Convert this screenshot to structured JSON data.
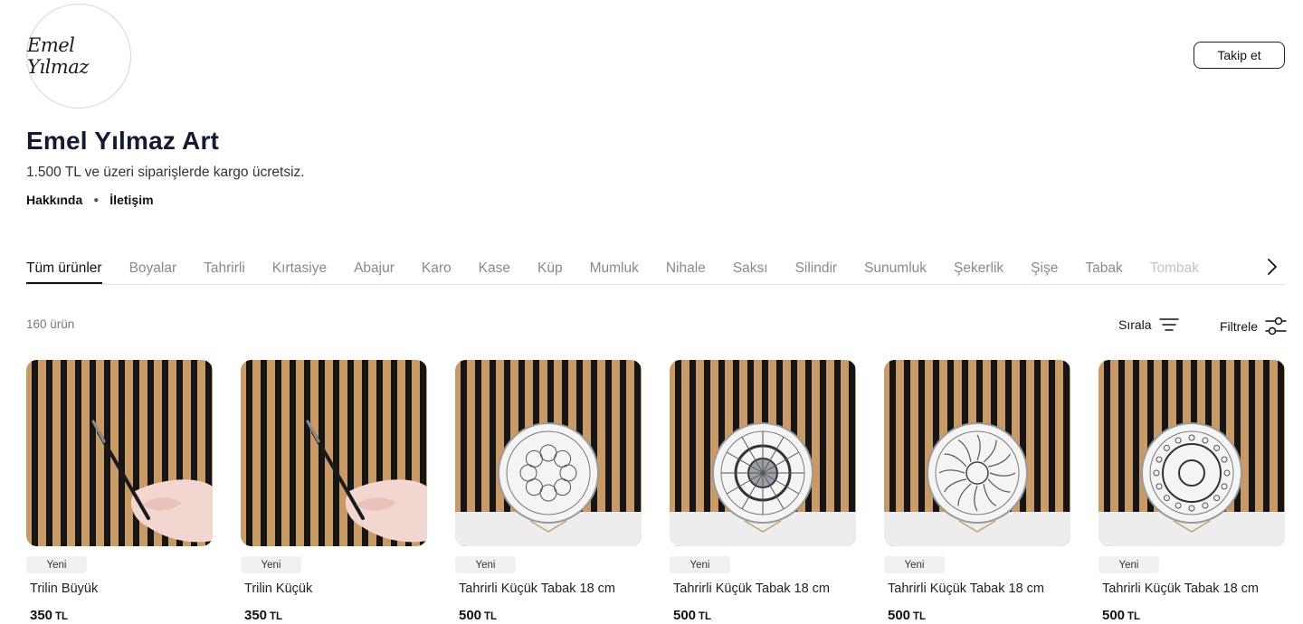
{
  "store": {
    "logo_text": "Emel Yılmaz",
    "name": "Emel Yılmaz Art",
    "description": "1.500 TL ve üzeri siparişlerde kargo ücretsiz.",
    "links": {
      "about": "Hakkında",
      "contact": "İletişim"
    },
    "follow_label": "Takip et"
  },
  "tabs": [
    "Tüm ürünler",
    "Boyalar",
    "Tahrirli",
    "Kırtasiye",
    "Abajur",
    "Karo",
    "Kase",
    "Küp",
    "Mumluk",
    "Nihale",
    "Saksı",
    "Silindir",
    "Sunumluk",
    "Şekerlik",
    "Şişe",
    "Tabak",
    "Tombak"
  ],
  "active_tab": "Tüm ürünler",
  "toolbar": {
    "count": "160 ürün",
    "sort_label": "Sırala",
    "filter_label": "Filtrele"
  },
  "products": [
    {
      "badge": "Yeni",
      "name": "Trilin Büyük",
      "price": "350",
      "currency": "TL",
      "image": "pen-holder"
    },
    {
      "badge": "Yeni",
      "name": "Trilin Küçük",
      "price": "350",
      "currency": "TL",
      "image": "pen-holder"
    },
    {
      "badge": "Yeni",
      "name": "Tahrirli Küçük Tabak 18 cm",
      "price": "500",
      "currency": "TL",
      "image": "plate-floral"
    },
    {
      "badge": "Yeni",
      "name": "Tahrirli Küçük Tabak 18 cm",
      "price": "500",
      "currency": "TL",
      "image": "plate-geometric"
    },
    {
      "badge": "Yeni",
      "name": "Tahrirli Küçük Tabak 18 cm",
      "price": "500",
      "currency": "TL",
      "image": "plate-sun"
    },
    {
      "badge": "Yeni",
      "name": "Tahrirli Küçük Tabak 18 cm",
      "price": "500",
      "currency": "TL",
      "image": "plate-rumi"
    }
  ],
  "icons": {
    "sort": "sort-lines-icon",
    "filter": "slider-filter-icon",
    "next": "chevron-right-icon"
  }
}
